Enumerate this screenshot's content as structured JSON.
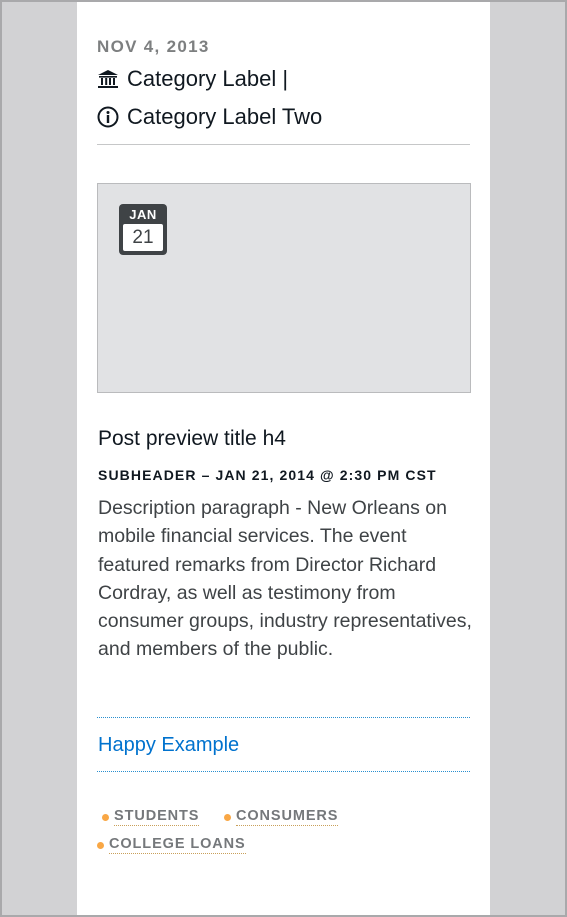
{
  "post": {
    "date": "NOV 4, 2013",
    "categories": [
      {
        "label": "Category Label |",
        "icon": "bank-icon"
      },
      {
        "label": "Category Label Two",
        "icon": "info-circle-icon"
      }
    ],
    "calendar": {
      "month": "JAN",
      "day": "21"
    },
    "title": "Post preview title h4",
    "subheader": "SUBHEADER  –  JAN 21, 2014 @ 2:30 PM CST",
    "description": "Description paragraph -  New Orleans on mobile financial services. The event featured remarks from Director Richard Cordray, as well as testimony from consumer groups, industry representatives, and members of the public.",
    "link_text": "Happy Example",
    "tags": [
      "STUDENTS",
      "CONSUMERS",
      "COLLEGE LOANS"
    ]
  },
  "colors": {
    "link": "#0072ce",
    "tag_dot": "#f9a745",
    "calendar_bg": "#3f4346",
    "media_bg": "#e1e2e4"
  }
}
